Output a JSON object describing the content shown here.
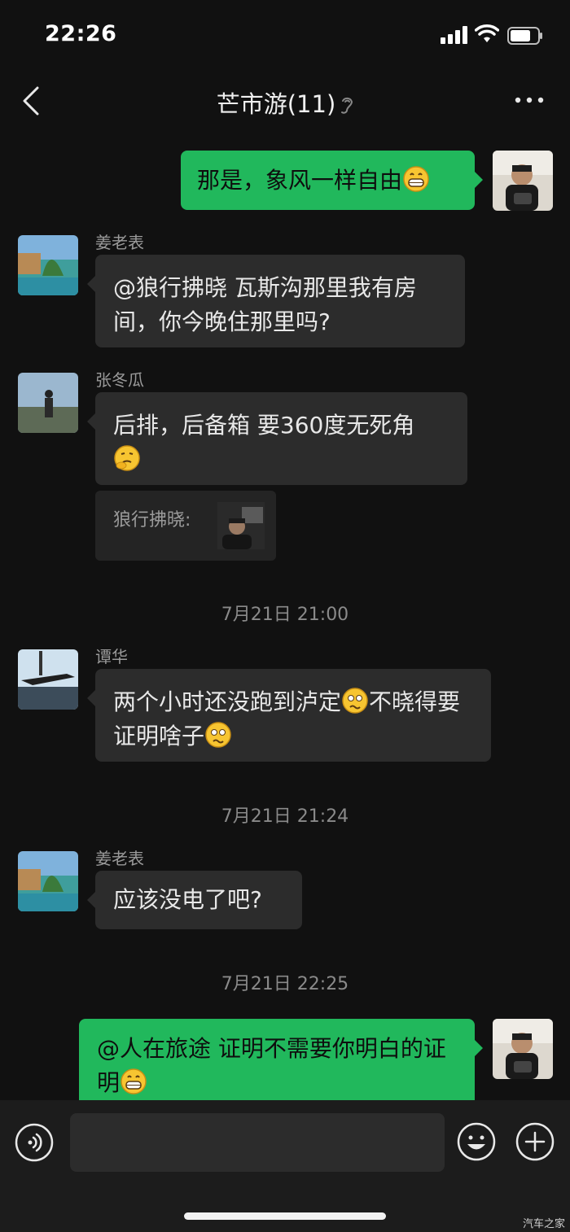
{
  "status": {
    "time": "22:26"
  },
  "nav": {
    "title": "芒市游(11)"
  },
  "messages": [
    {
      "text": "那是，象风一样自由",
      "emoji": "grin"
    },
    {
      "sender": "姜老表",
      "text": "@狼行拂晓 瓦斯沟那里我有房间，你今晚住那里吗?"
    },
    {
      "sender": "张冬瓜",
      "text": "后排，后备箱 要360度无死角",
      "emoji": "thinking"
    },
    {
      "quote_label": "狼行拂晓:"
    },
    {
      "sender": "谭华",
      "text_a": "两个小时还没跑到泸定",
      "text_b": "不晓得要证明啥子"
    },
    {
      "sender": "姜老表",
      "text": "应该没电了吧?"
    },
    {
      "text": "@人在旅途 证明不需要你明白的证明",
      "emoji": "grin"
    }
  ],
  "timestamps": [
    "7月21日 21:00",
    "7月21日 21:24",
    "7月21日 22:25"
  ],
  "watermark": "汽车之家",
  "colors": {
    "self_bubble": "#21b85c",
    "other_bubble": "#2c2c2c",
    "background": "#111111"
  },
  "icons": [
    "back-chevron-icon",
    "ear-icon",
    "more-icon",
    "voice-icon",
    "emoji-icon",
    "plus-icon",
    "signal-icon",
    "wifi-icon",
    "battery-icon"
  ]
}
